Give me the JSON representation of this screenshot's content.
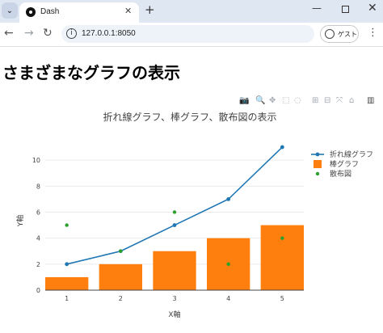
{
  "browser": {
    "tab_title": "Dash",
    "tab_close": "✕",
    "new_tab": "+",
    "url": "127.0.0.1:8050",
    "profile_label": "ゲスト",
    "menu_icon": "kebab-menu-icon"
  },
  "page": {
    "title": "さまざまなグラフの表示"
  },
  "modebar": {
    "icons": [
      "camera-icon",
      "zoom-icon",
      "pan-icon",
      "box-select-icon",
      "lasso-icon",
      "zoom-in-icon",
      "zoom-out-icon",
      "autoscale-icon",
      "reset-axes-icon",
      "plotly-logo-icon"
    ]
  },
  "chart_data": {
    "type": "line",
    "title": "折れ線グラフ、棒グラフ、散布図の表示",
    "xlabel": "X軸",
    "ylabel": "Y軸",
    "x": [
      1,
      2,
      3,
      4,
      5
    ],
    "xlim": [
      0.6,
      5.4
    ],
    "ylim": [
      0,
      11.5
    ],
    "yticks": [
      0,
      2,
      4,
      6,
      8,
      10
    ],
    "grid": true,
    "legend_position": "top-right",
    "series": [
      {
        "name": "折れ線グラフ",
        "type": "line",
        "color": "#1f77b4",
        "values": [
          2,
          3,
          5,
          7,
          11
        ]
      },
      {
        "name": "棒グラフ",
        "type": "bar",
        "color": "#ff7f0e",
        "values": [
          1,
          2,
          3,
          4,
          5
        ]
      },
      {
        "name": "散布図",
        "type": "scatter",
        "color": "#2ca02c",
        "values": [
          5,
          3,
          6,
          2,
          4
        ]
      }
    ]
  }
}
